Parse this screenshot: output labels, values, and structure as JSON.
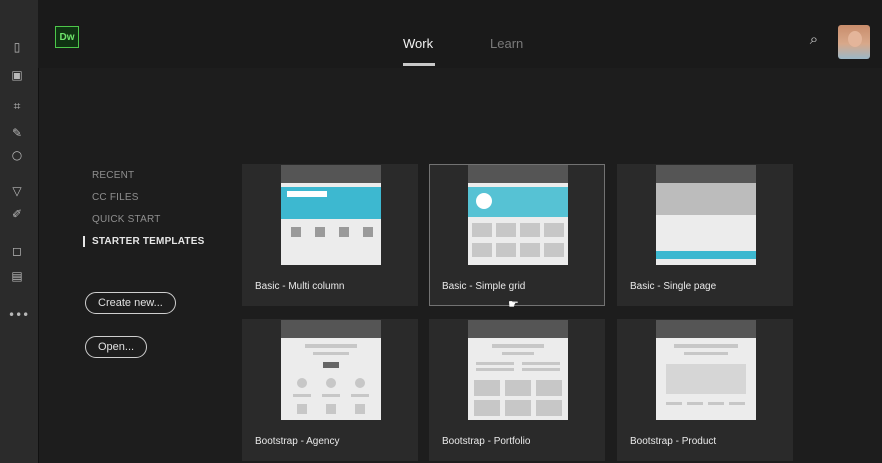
{
  "app": {
    "logo_text": "Dw",
    "accent": "#4dc74a"
  },
  "nav": {
    "tabs": [
      {
        "label": "Work",
        "active": true
      },
      {
        "label": "Learn",
        "active": false
      }
    ]
  },
  "toolbar": {
    "icons": [
      "file-icon",
      "folder-icon",
      "code-icon",
      "pen-icon",
      "circle-icon",
      "filter-icon",
      "edit-icon",
      "chat-icon",
      "panel-icon",
      "more-icon"
    ]
  },
  "sidebar": {
    "items": [
      {
        "label": "RECENT",
        "active": false
      },
      {
        "label": "CC FILES",
        "active": false
      },
      {
        "label": "QUICK START",
        "active": false
      },
      {
        "label": "STARTER TEMPLATES",
        "active": true
      }
    ]
  },
  "actions": {
    "create_label": "Create new...",
    "open_label": "Open..."
  },
  "templates": [
    {
      "label": "Basic - Multi column"
    },
    {
      "label": "Basic - Simple grid"
    },
    {
      "label": "Basic - Single page"
    },
    {
      "label": "Bootstrap - Agency"
    },
    {
      "label": "Bootstrap - Portfolio"
    },
    {
      "label": "Bootstrap - Product"
    }
  ]
}
